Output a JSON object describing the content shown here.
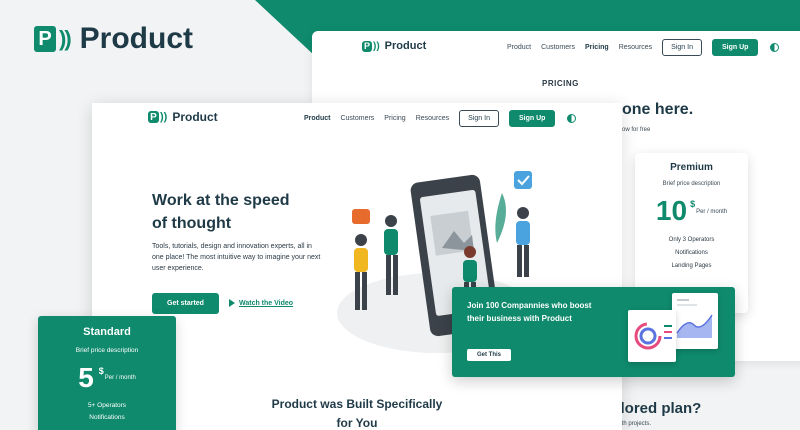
{
  "brand": {
    "name": "Product",
    "color": "#0f8a6c"
  },
  "back_window": {
    "nav": [
      "Product",
      "Customers",
      "Pricing",
      "Resources"
    ],
    "sign_in": "Sign In",
    "sign_up": "Sign Up",
    "pricing_label": "PRICING",
    "headline_partial": "one here.",
    "sub_partial": "ow for free",
    "bottom_headline_partial": "ailored plan?",
    "bottom_sub_partial": "ns with projects."
  },
  "premium_card": {
    "title": "Premium",
    "description": "Brief price description",
    "price": "10",
    "currency": "$",
    "per": "Per / month",
    "features": [
      "Only 3 Operators",
      "Notifications",
      "Landing Pages"
    ]
  },
  "front_window": {
    "nav": [
      "Product",
      "Customers",
      "Pricing",
      "Resources"
    ],
    "sign_in": "Sign In",
    "sign_up": "Sign Up",
    "hero_title_line1": "Work at the speed",
    "hero_title_line2": "of thought",
    "hero_text": "Tools, tutorials, design and innovation experts, all in one place! The most intuitive way to imagine your next user experience.",
    "get_started": "Get started",
    "watch_video": "Watch the Video",
    "built_line1": "Product  was Built Specifically",
    "built_line2": "for You"
  },
  "standard_card": {
    "title": "Standard",
    "description": "Brief price description",
    "price": "5",
    "currency": "$",
    "per": "Per / month",
    "features": [
      "5+ Operators",
      "Notifications"
    ]
  },
  "join_banner": {
    "text": "Join 100 Compannies who boost their business with Product",
    "button": "Get This"
  }
}
